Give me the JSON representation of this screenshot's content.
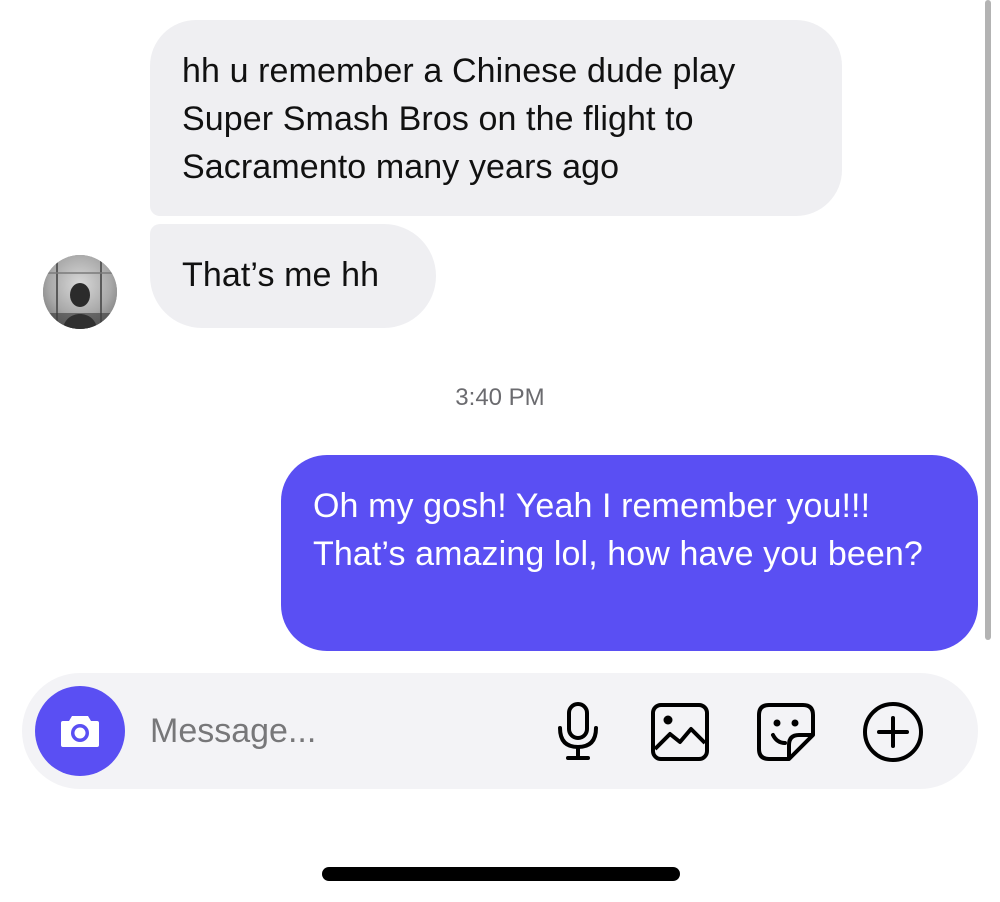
{
  "conversation": {
    "messages": [
      {
        "sender": "other",
        "text": "hh u remember a Chinese dude play Super Smash Bros on the flight to Sacramento many years ago"
      },
      {
        "sender": "other",
        "text": "That’s me hh"
      },
      {
        "sender": "me",
        "text": "Oh my gosh! Yeah I remember you!!! That’s amazing lol, how have you been?"
      }
    ],
    "timestamp": "3:40 PM"
  },
  "composer": {
    "placeholder": "Message...",
    "icons": [
      "camera-icon",
      "microphone-icon",
      "image-icon",
      "sticker-icon",
      "plus-icon"
    ]
  },
  "colors": {
    "accent": "#5a4ff3",
    "incoming_bubble": "#efeff2",
    "composer_bg": "#f3f3f6"
  }
}
